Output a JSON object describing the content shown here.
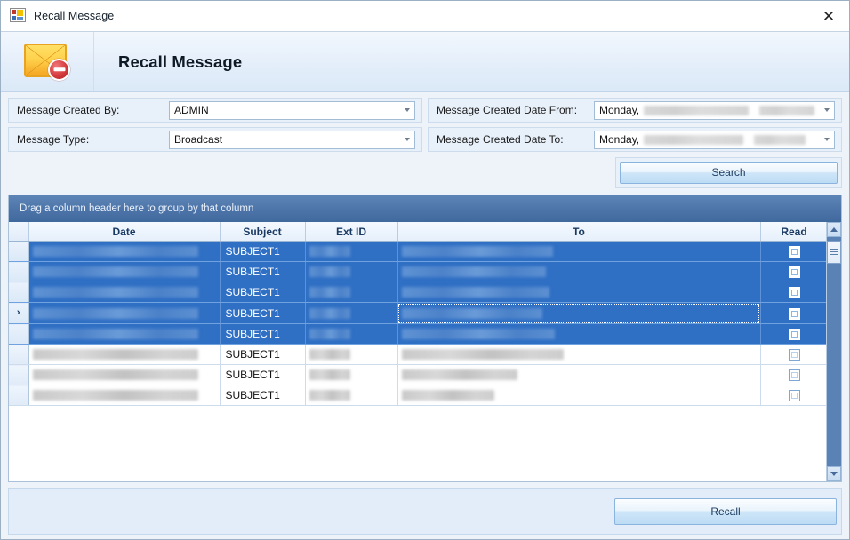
{
  "window": {
    "title": "Recall Message",
    "icon": "vb-form-icon",
    "close_label": "✕"
  },
  "banner": {
    "icon": "recall-message-envelope-icon",
    "title": "Recall Message"
  },
  "criteria": {
    "fields": [
      {
        "label": "Message Created By:",
        "value": "ADMIN",
        "redacted": false,
        "control": "combobox"
      },
      {
        "label": "Message Created Date From:",
        "value": "Monday,",
        "redacted": true,
        "control": "datepicker"
      },
      {
        "label": "Message Type:",
        "value": "Broadcast",
        "redacted": false,
        "control": "combobox"
      },
      {
        "label": "Message Created Date To:",
        "value": "Monday,",
        "redacted": true,
        "control": "datepicker"
      }
    ],
    "search_label": "Search"
  },
  "grid": {
    "group_panel_text": "Drag a column header here to group by that column",
    "columns": [
      "Date",
      "Subject",
      "Ext ID",
      "To",
      "Read"
    ],
    "rows": [
      {
        "date": "",
        "date_redacted": true,
        "subject": "SUBJECT1",
        "ext_id": "",
        "ext_redacted": true,
        "to": "",
        "to_redacted": true,
        "read": false,
        "selected": true,
        "indicator": ""
      },
      {
        "date": "",
        "date_redacted": true,
        "subject": "SUBJECT1",
        "ext_id": "",
        "ext_redacted": true,
        "to": "",
        "to_redacted": true,
        "read": false,
        "selected": true,
        "indicator": ""
      },
      {
        "date": "",
        "date_redacted": true,
        "subject": "SUBJECT1",
        "ext_id": "",
        "ext_redacted": true,
        "to": "",
        "to_redacted": true,
        "read": false,
        "selected": true,
        "indicator": ""
      },
      {
        "date": "",
        "date_redacted": true,
        "subject": "SUBJECT1",
        "ext_id": "",
        "ext_redacted": true,
        "to": "",
        "to_redacted": true,
        "read": false,
        "selected": true,
        "indicator": "›"
      },
      {
        "date": "",
        "date_redacted": true,
        "subject": "SUBJECT1",
        "ext_id": "",
        "ext_redacted": true,
        "to": "",
        "to_redacted": true,
        "read": false,
        "selected": true,
        "indicator": ""
      },
      {
        "date": "",
        "date_redacted": true,
        "subject": "SUBJECT1",
        "ext_id": "",
        "ext_redacted": true,
        "to": "",
        "to_redacted": true,
        "read": false,
        "selected": false,
        "indicator": ""
      },
      {
        "date": "",
        "date_redacted": true,
        "subject": "SUBJECT1",
        "ext_id": "",
        "ext_redacted": true,
        "to": "",
        "to_redacted": true,
        "read": false,
        "selected": false,
        "indicator": ""
      },
      {
        "date": "",
        "date_redacted": true,
        "subject": "SUBJECT1",
        "ext_id": "",
        "ext_redacted": true,
        "to": "",
        "to_redacted": true,
        "read": false,
        "selected": false,
        "indicator": ""
      }
    ],
    "scrollbar": {
      "up_label": "scroll-up",
      "down_label": "scroll-down",
      "thumb_label": "scroll-thumb"
    }
  },
  "footer": {
    "recall_label": "Recall"
  },
  "colors": {
    "selection_blue": "#2f6fc4",
    "group_panel_blue": "#4c73a7",
    "panel_blue": "#e8f0fa",
    "header_gradient_top": "#f4f9ff",
    "button_blue": "#bcdcf5",
    "window_border": "#9cb0c4"
  }
}
